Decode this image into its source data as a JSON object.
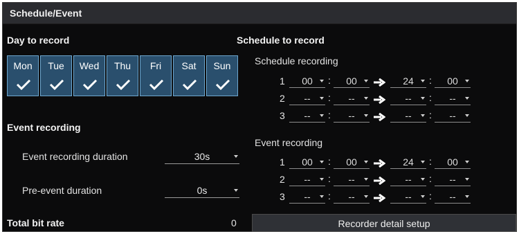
{
  "window": {
    "title": "Schedule/Event"
  },
  "day_to_record": {
    "title": "Day to record",
    "days": [
      "Mon",
      "Tue",
      "Wed",
      "Thu",
      "Fri",
      "Sat",
      "Sun"
    ],
    "checked_icon": "check-icon"
  },
  "event_recording": {
    "title": "Event recording",
    "duration_label": "Event recording duration",
    "duration_value": "30s",
    "pre_label": "Pre-event duration",
    "pre_value": "0s"
  },
  "total_bit_rate": {
    "label": "Total bit rate",
    "value": "0"
  },
  "schedule_to_record": {
    "title": "Schedule to record",
    "schedule_recording": {
      "label": "Schedule recording",
      "rows": [
        {
          "num": "1",
          "start_h": "00",
          "start_m": "00",
          "end_h": "24",
          "end_m": "00"
        },
        {
          "num": "2",
          "start_h": "--",
          "start_m": "--",
          "end_h": "--",
          "end_m": "--"
        },
        {
          "num": "3",
          "start_h": "--",
          "start_m": "--",
          "end_h": "--",
          "end_m": "--"
        }
      ]
    },
    "event_recording": {
      "label": "Event recording",
      "rows": [
        {
          "num": "1",
          "start_h": "00",
          "start_m": "00",
          "end_h": "24",
          "end_m": "00"
        },
        {
          "num": "2",
          "start_h": "--",
          "start_m": "--",
          "end_h": "--",
          "end_m": "--"
        },
        {
          "num": "3",
          "start_h": "--",
          "start_m": "--",
          "end_h": "--",
          "end_m": "--"
        }
      ]
    }
  },
  "buttons": {
    "recorder_detail": "Recorder detail setup"
  },
  "colors": {
    "panel_bg": "#0b0b0c",
    "day_fill": "#2a4f6d",
    "day_border": "#6da7cf",
    "titlebar": "#2b2c30"
  }
}
